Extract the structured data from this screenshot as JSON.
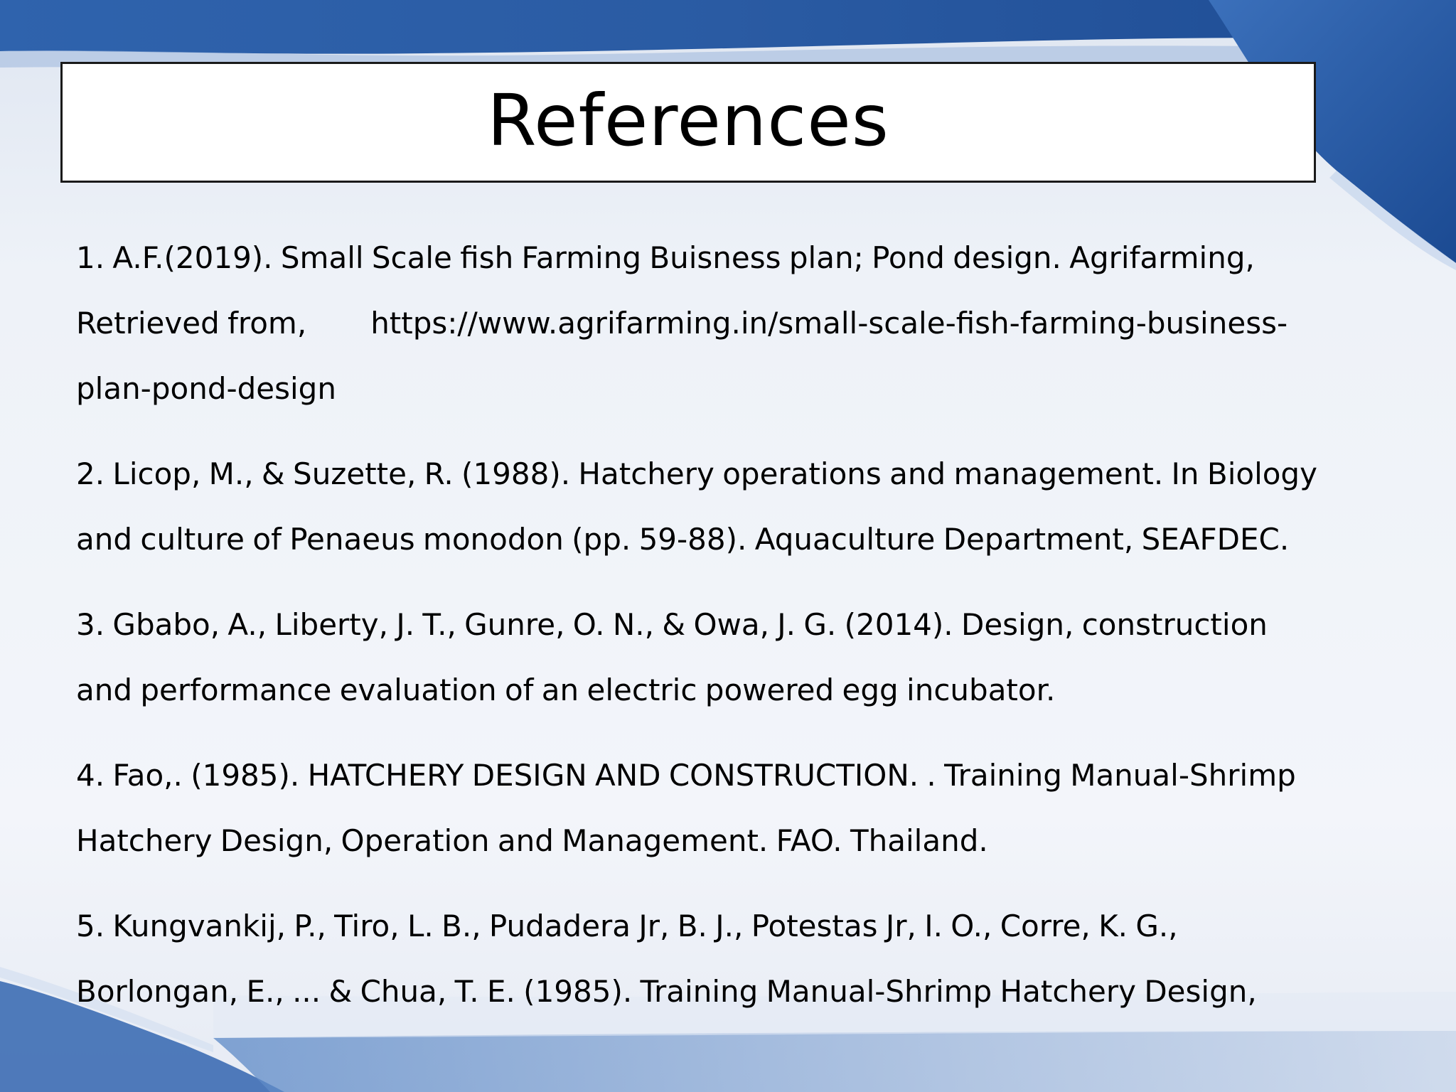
{
  "slide": {
    "title": "References",
    "references": [
      {
        "line1": "1. A.F.(2019). Small Scale fish Farming Buisness plan; Pond design. Agrifarming,",
        "line2_prefix": "Retrieved from,",
        "line2_url": "https://www.agrifarming.in/small-scale-fish-farming-business-",
        "line3": "plan-pond-design"
      },
      {
        "text": "2. Licop, M., & Suzette, R. (1988). Hatchery operations and management. In Biology and culture of Penaeus monodon (pp. 59-88). Aquaculture Department, SEAFDEC."
      },
      {
        "text": "3. Gbabo, A., Liberty, J. T., Gunre, O. N., & Owa, J. G. (2014). Design, construction and performance evaluation of an electric powered egg incubator."
      },
      {
        "text": "4. Fao,. (1985).  HATCHERY DESIGN AND CONSTRUCTION. . Training Manual-Shrimp Hatchery Design, Operation and Management. FAO. Thailand."
      },
      {
        "text": "5. Kungvankij, P., Tiro, L. B., Pudadera Jr, B. J., Potestas Jr, I. O., Corre, K. G., Borlongan, E., ... & Chua, T. E. (1985). Training Manual-Shrimp Hatchery Design,"
      }
    ]
  },
  "colors": {
    "background_light": "#eef1f7",
    "accent_blue": "#2e5fa8",
    "dark_blue": "#1d4a8f",
    "text": "#000000"
  }
}
